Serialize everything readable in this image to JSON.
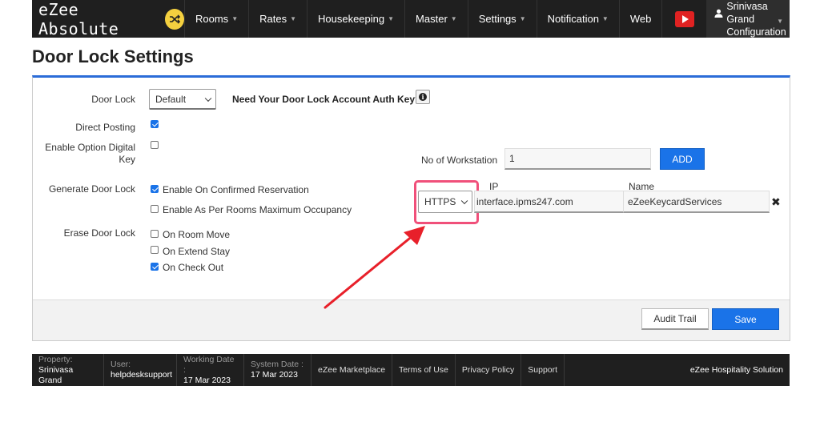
{
  "app": {
    "brand": "eZee Absolute",
    "nav": [
      {
        "label": "Rooms",
        "dropdown": true
      },
      {
        "label": "Rates",
        "dropdown": true
      },
      {
        "label": "Housekeeping",
        "dropdown": true
      },
      {
        "label": "Master",
        "dropdown": true
      },
      {
        "label": "Settings",
        "dropdown": true
      },
      {
        "label": "Notification",
        "dropdown": true
      },
      {
        "label": "Web",
        "dropdown": false
      }
    ],
    "user_line1": "Srinivasa Grand",
    "user_line2": "Configuration"
  },
  "page": {
    "title": "Door Lock Settings"
  },
  "form": {
    "door_lock_label": "Door Lock",
    "door_lock_value": "Default",
    "auth_key_text": "Need Your Door Lock Account Auth Key?",
    "direct_posting_label": "Direct Posting",
    "direct_posting_checked": true,
    "digital_key_label_1": "Enable Option Digital",
    "digital_key_label_2": "Key",
    "digital_key_checked": false,
    "generate_label": "Generate Door Lock",
    "generate_options": [
      {
        "label": "Enable On Confirmed Reservation",
        "checked": true
      },
      {
        "label": "Enable As Per Rooms Maximum Occupancy",
        "checked": false
      }
    ],
    "erase_label": "Erase Door Lock",
    "erase_options": [
      {
        "label": "On Room Move",
        "checked": false
      },
      {
        "label": "On Extend Stay",
        "checked": false
      },
      {
        "label": "On Check Out",
        "checked": true
      }
    ],
    "workstation_label": "No of Workstation",
    "workstation_value": "1",
    "add_label": "ADD",
    "ip_header": "IP",
    "name_header": "Name",
    "protocol_value": "HTTPS",
    "ip_value": "interface.ipms247.com",
    "name_value": "eZeeKeycardServices",
    "audit_label": "Audit Trail",
    "save_label": "Save"
  },
  "footer": {
    "property_key": "Property:",
    "property_val": "Srinivasa Grand",
    "user_key": "User:",
    "user_val": "helpdesksupport",
    "working_key": "Working Date :",
    "working_val": "17 Mar 2023",
    "system_key": "System Date :",
    "system_val": "17 Mar 2023",
    "links": [
      "eZee Marketplace",
      "Terms of Use",
      "Privacy Policy",
      "Support"
    ],
    "company": "eZee Hospitality Solution"
  },
  "colors": {
    "accent": "#1a73e8",
    "highlight": "#f0507a",
    "arrow": "#e8202a",
    "nav_bg": "#1f1f1f"
  }
}
